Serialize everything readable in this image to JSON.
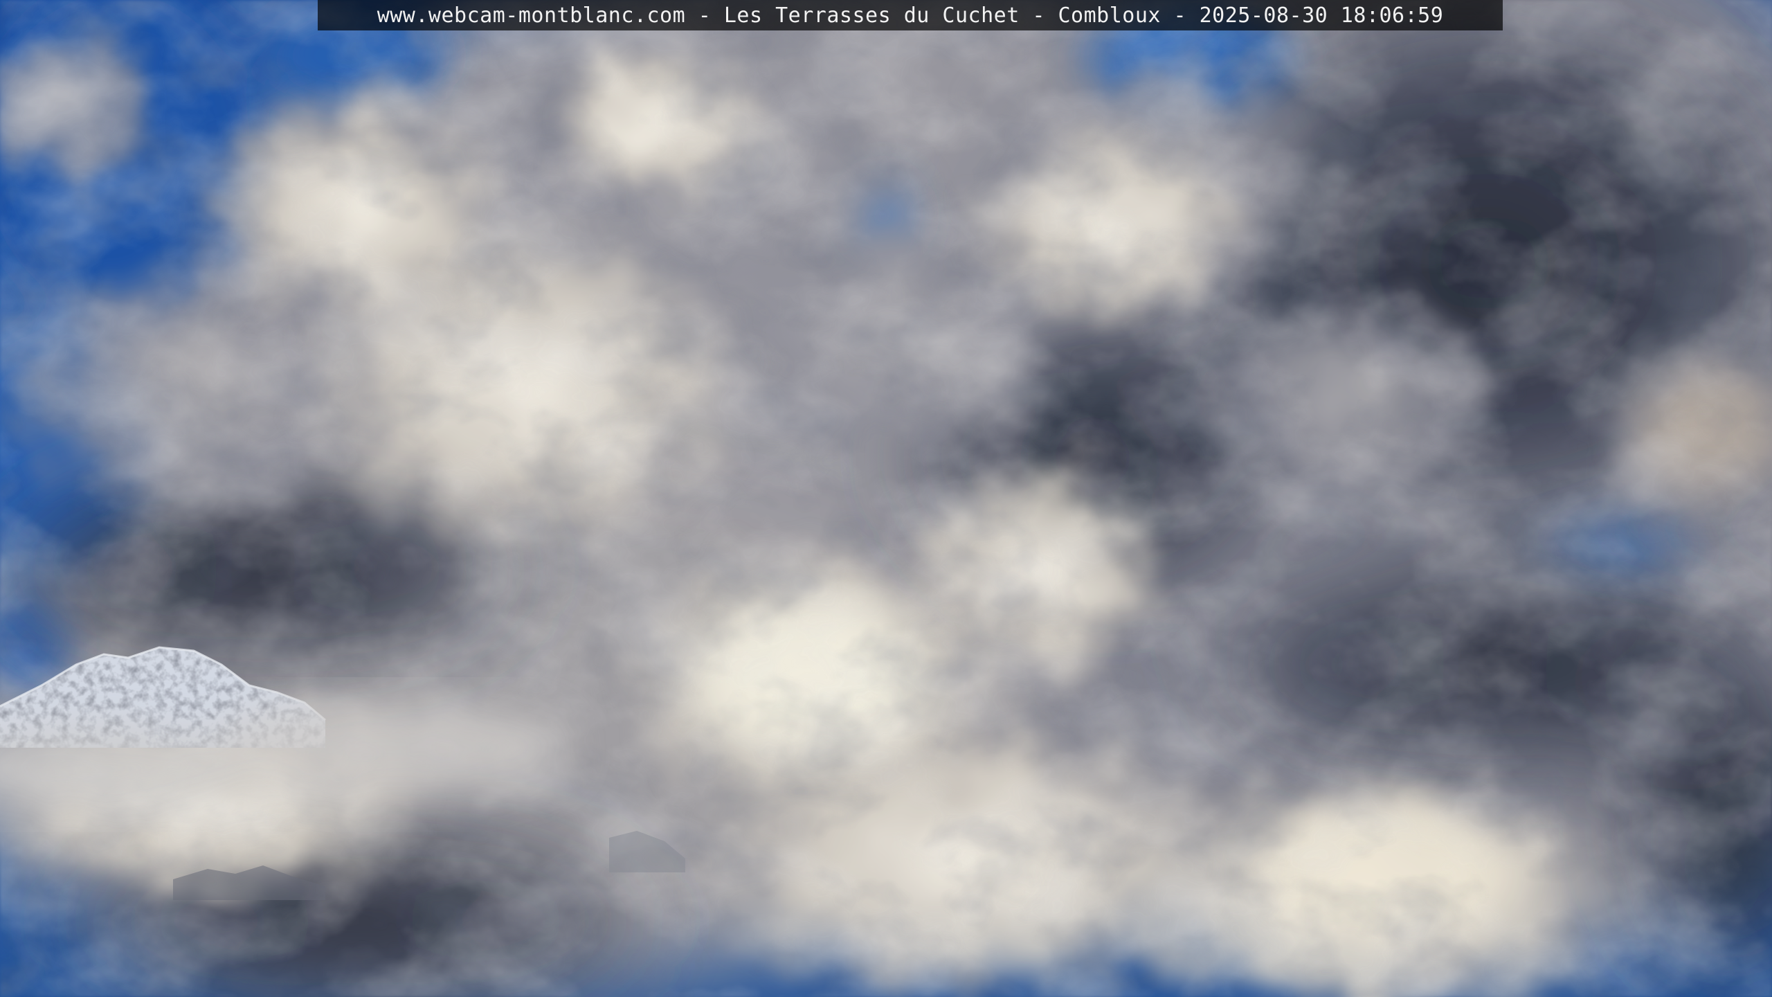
{
  "overlay": {
    "caption": "www.webcam-montblanc.com - Les Terrasses du Cuchet - Combloux - 2025-08-30 18:06:59"
  },
  "scene": {
    "subject": "cloud-covered sky with snowy mountain ridge",
    "colors": {
      "sky_blue": "#1f5bb0",
      "cloud_light": "#ece8df",
      "cloud_mid": "#a6a6ad",
      "cloud_dark": "#2e3447",
      "snow": "#e9eef5",
      "rock": "#5a5f6b"
    }
  }
}
